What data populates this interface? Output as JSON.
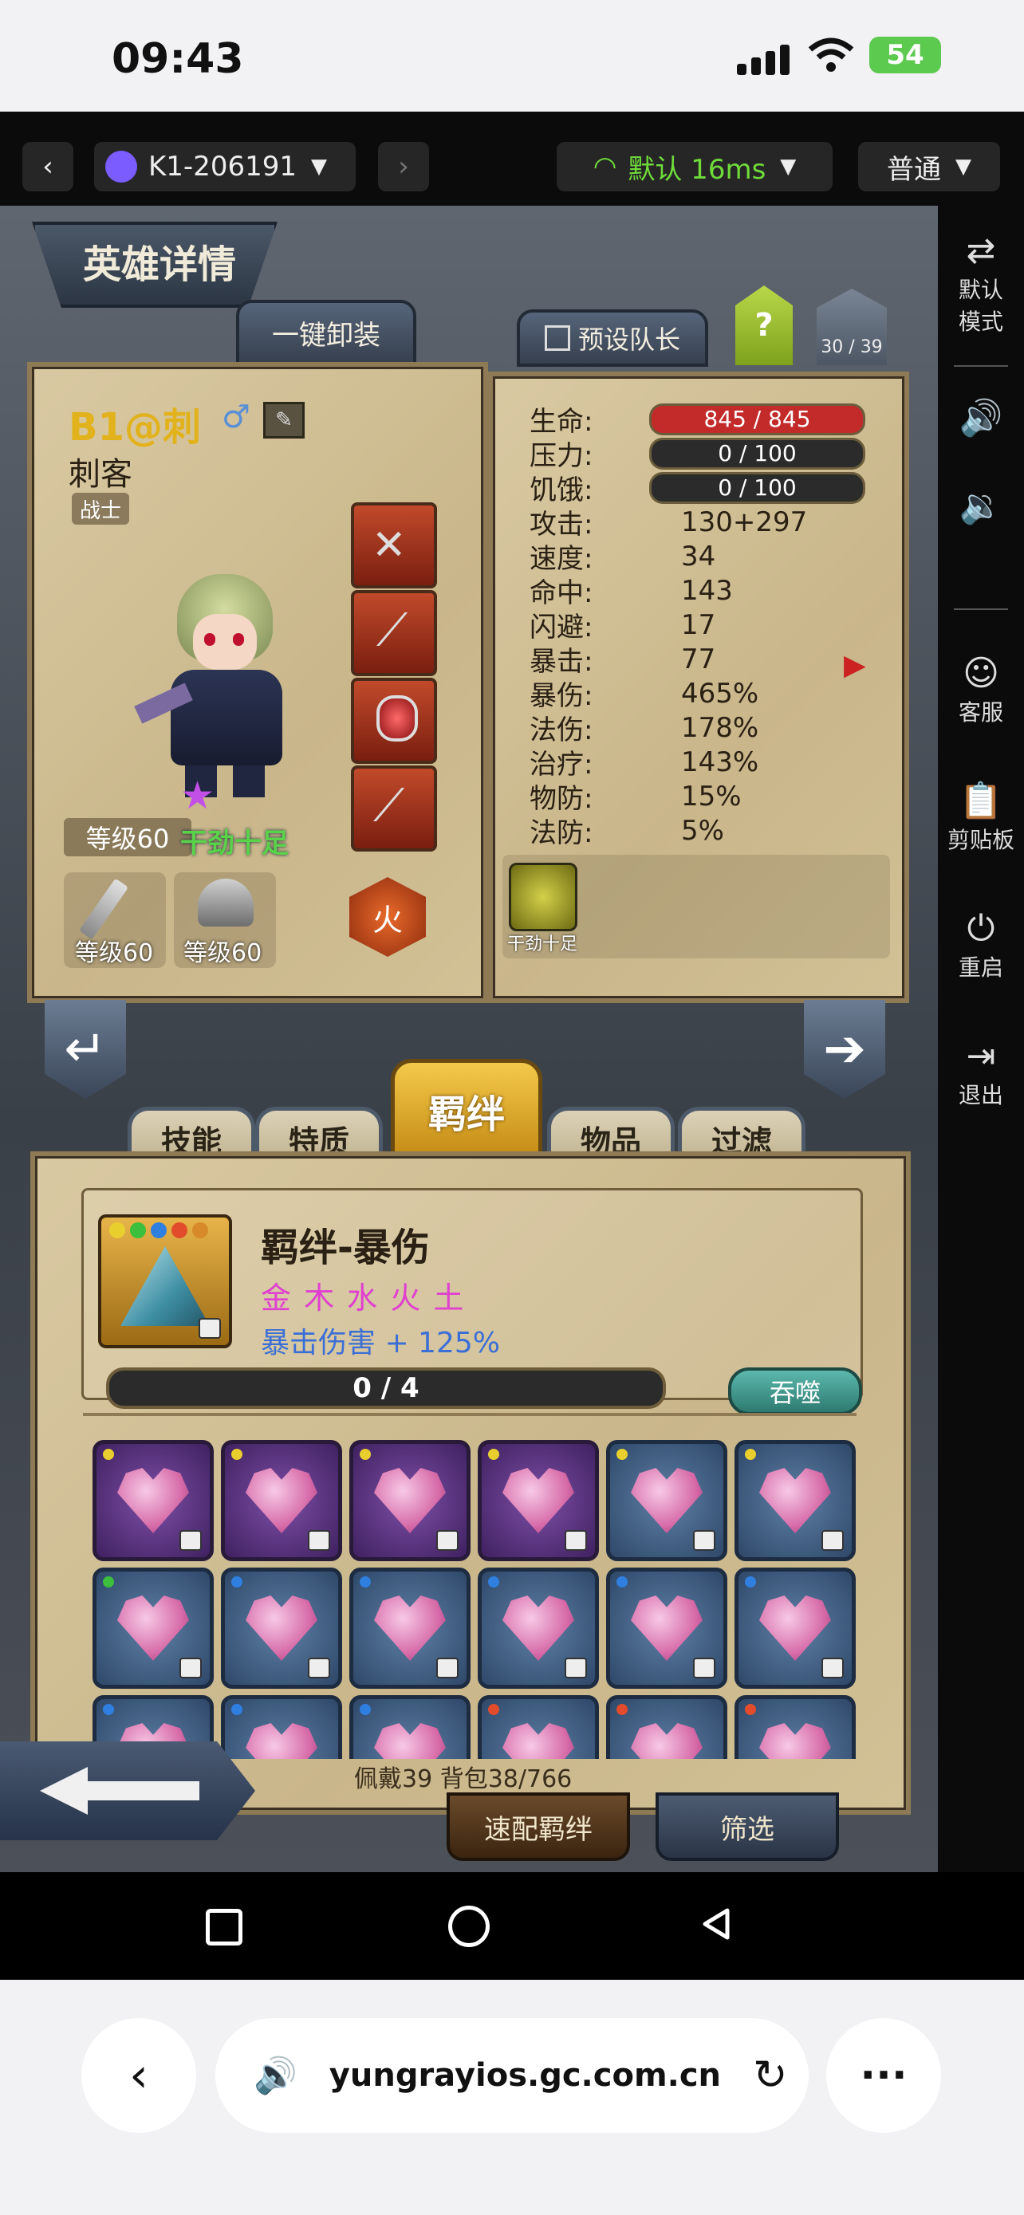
{
  "status_bar": {
    "time": "09:43",
    "battery": "54"
  },
  "toolbar": {
    "device": "K1-206191",
    "network": "默认 16ms",
    "quality": "普通"
  },
  "side_panel": {
    "items": [
      {
        "label": "默认\n模式",
        "icon": "swap-icon"
      },
      {
        "label": "",
        "icon": "volume-up-icon"
      },
      {
        "label": "",
        "icon": "volume-down-icon"
      },
      {
        "label": "客服",
        "icon": "support-icon"
      },
      {
        "label": "剪贴板",
        "icon": "clipboard-icon"
      },
      {
        "label": "重启",
        "icon": "power-icon"
      },
      {
        "label": "退出",
        "icon": "exit-icon"
      }
    ]
  },
  "game": {
    "title": "英雄详情",
    "unequip_all": "一键卸装",
    "preset_leader": "预设队长",
    "help": "?",
    "team_count": "30 / 39",
    "hero": {
      "name": "B1@刺",
      "class": "刺客",
      "role": "战士",
      "level": "等级60",
      "mood": "干劲十足",
      "weapon_level": "等级60",
      "armor_level": "等级60",
      "element": "火"
    },
    "stats": [
      {
        "label": "生命:",
        "value": "845 / 845",
        "type": "bar-red"
      },
      {
        "label": "压力:",
        "value": "0 / 100",
        "type": "bar"
      },
      {
        "label": "饥饿:",
        "value": "0 / 100",
        "type": "bar"
      },
      {
        "label": "攻击:",
        "value": "130+297"
      },
      {
        "label": "速度:",
        "value": "34"
      },
      {
        "label": "命中:",
        "value": "143"
      },
      {
        "label": "闪避:",
        "value": "17"
      },
      {
        "label": "暴击:",
        "value": "77"
      },
      {
        "label": "暴伤:",
        "value": "465%"
      },
      {
        "label": "法伤:",
        "value": "178%"
      },
      {
        "label": "治疗:",
        "value": "143%"
      },
      {
        "label": "物防:",
        "value": "15%"
      },
      {
        "label": "法防:",
        "value": "5%"
      }
    ],
    "status_effect": "干劲十足",
    "tabs": [
      "技能",
      "特质",
      "羁绊",
      "物品",
      "过滤"
    ],
    "active_tab": "羁绊",
    "bond": {
      "name": "羁绊-暴伤",
      "elements": "金 木 水 火 土",
      "effect": "暴击伤害 + 125%",
      "progress_text": "0 / 4",
      "progress": 0,
      "devour": "吞噬"
    },
    "inventory": {
      "summary": "佩戴39 背包38/766",
      "quick_match": "速配羁绊",
      "filter": "筛选"
    }
  },
  "browser": {
    "url": "yungrayios.gc.com.cn"
  }
}
